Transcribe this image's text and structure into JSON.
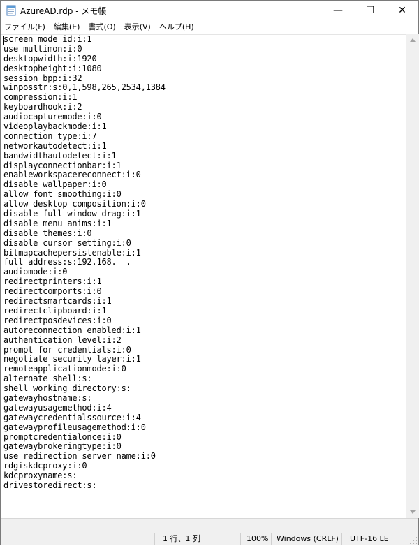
{
  "window": {
    "title": "AzureAD.rdp - メモ帳",
    "minimize_label": "—",
    "maximize_label": "☐",
    "close_label": "✕"
  },
  "menu": {
    "items": [
      {
        "label": "ファイル(F)"
      },
      {
        "label": "編集(E)"
      },
      {
        "label": "書式(O)"
      },
      {
        "label": "表示(V)"
      },
      {
        "label": "ヘルプ(H)"
      }
    ]
  },
  "editor": {
    "lines": [
      "screen mode id:i:1",
      "use multimon:i:0",
      "desktopwidth:i:1920",
      "desktopheight:i:1080",
      "session bpp:i:32",
      "winposstr:s:0,1,598,265,2534,1384",
      "compression:i:1",
      "keyboardhook:i:2",
      "audiocapturemode:i:0",
      "videoplaybackmode:i:1",
      "connection type:i:7",
      "networkautodetect:i:1",
      "bandwidthautodetect:i:1",
      "displayconnectionbar:i:1",
      "enableworkspacereconnect:i:0",
      "disable wallpaper:i:0",
      "allow font smoothing:i:0",
      "allow desktop composition:i:0",
      "disable full window drag:i:1",
      "disable menu anims:i:1",
      "disable themes:i:0",
      "disable cursor setting:i:0",
      "bitmapcachepersistenable:i:1",
      "full address:s:192.168.  .",
      "audiomode:i:0",
      "redirectprinters:i:1",
      "redirectcomports:i:0",
      "redirectsmartcards:i:1",
      "redirectclipboard:i:1",
      "redirectposdevices:i:0",
      "autoreconnection enabled:i:1",
      "authentication level:i:2",
      "prompt for credentials:i:0",
      "negotiate security layer:i:1",
      "remoteapplicationmode:i:0",
      "alternate shell:s:",
      "shell working directory:s:",
      "gatewayhostname:s:",
      "gatewayusagemethod:i:4",
      "gatewaycredentialssource:i:4",
      "gatewayprofileusagemethod:i:0",
      "promptcredentialonce:i:0",
      "gatewaybrokeringtype:i:0",
      "use redirection server name:i:0",
      "rdgiskdcproxy:i:0",
      "kdcproxyname:s:",
      "drivestoredirect:s:"
    ]
  },
  "status": {
    "position": "1 行、1 列",
    "zoom": "100%",
    "line_ending": "Windows (CRLF)",
    "encoding": "UTF-16 LE"
  },
  "icons": {
    "app": "notepad-icon",
    "scroll_up": "chevron-up-icon",
    "scroll_down": "chevron-down-icon",
    "grip": "resize-grip-icon"
  }
}
